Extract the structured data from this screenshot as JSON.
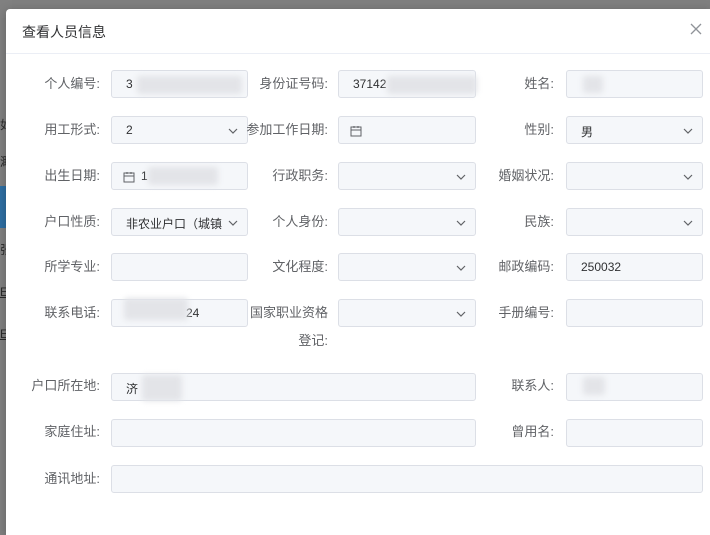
{
  "dialog": {
    "title": "查看人员信息",
    "close_icon": "close-icon"
  },
  "background": {
    "fragments": [
      "如",
      "渺",
      "张",
      "EX",
      "EX"
    ]
  },
  "fields": {
    "personal_no": {
      "label": "个人编号:",
      "value": "3"
    },
    "id_number": {
      "label": "身份证号码:",
      "value": "37142"
    },
    "name": {
      "label": "姓名:",
      "value": ""
    },
    "employment_form": {
      "label": "用工形式:",
      "value": "2"
    },
    "work_start_date": {
      "label": "参加工作日期:",
      "value": ""
    },
    "gender": {
      "label": "性别:",
      "value": "男"
    },
    "birth_date": {
      "label": "出生日期:",
      "value": "1"
    },
    "admin_position": {
      "label": "行政职务:",
      "value": ""
    },
    "marital_status": {
      "label": "婚姻状况:",
      "value": ""
    },
    "hukou_type": {
      "label": "户口性质:",
      "value": "非农业户口（城镇"
    },
    "personal_identity": {
      "label": "个人身份:",
      "value": ""
    },
    "ethnicity": {
      "label": "民族:",
      "value": ""
    },
    "major": {
      "label": "所学专业:",
      "value": ""
    },
    "education": {
      "label": "文化程度:",
      "value": ""
    },
    "postal_code": {
      "label": "邮政编码:",
      "value": "250032"
    },
    "phone": {
      "label": "联系电话:",
      "value": "24"
    },
    "qualification_line1": {
      "label": "国家职业资格",
      "value": ""
    },
    "qualification_line2": {
      "label": "登记:",
      "value": ""
    },
    "handbook_no": {
      "label": "手册编号:",
      "value": ""
    },
    "hukou_location": {
      "label": "户口所在地:",
      "value": "济"
    },
    "contact_person": {
      "label": "联系人:",
      "value": ""
    },
    "home_address": {
      "label": "家庭住址:",
      "value": ""
    },
    "former_name": {
      "label": "曾用名:",
      "value": ""
    },
    "mailing_address": {
      "label": "通讯地址:",
      "value": ""
    }
  }
}
